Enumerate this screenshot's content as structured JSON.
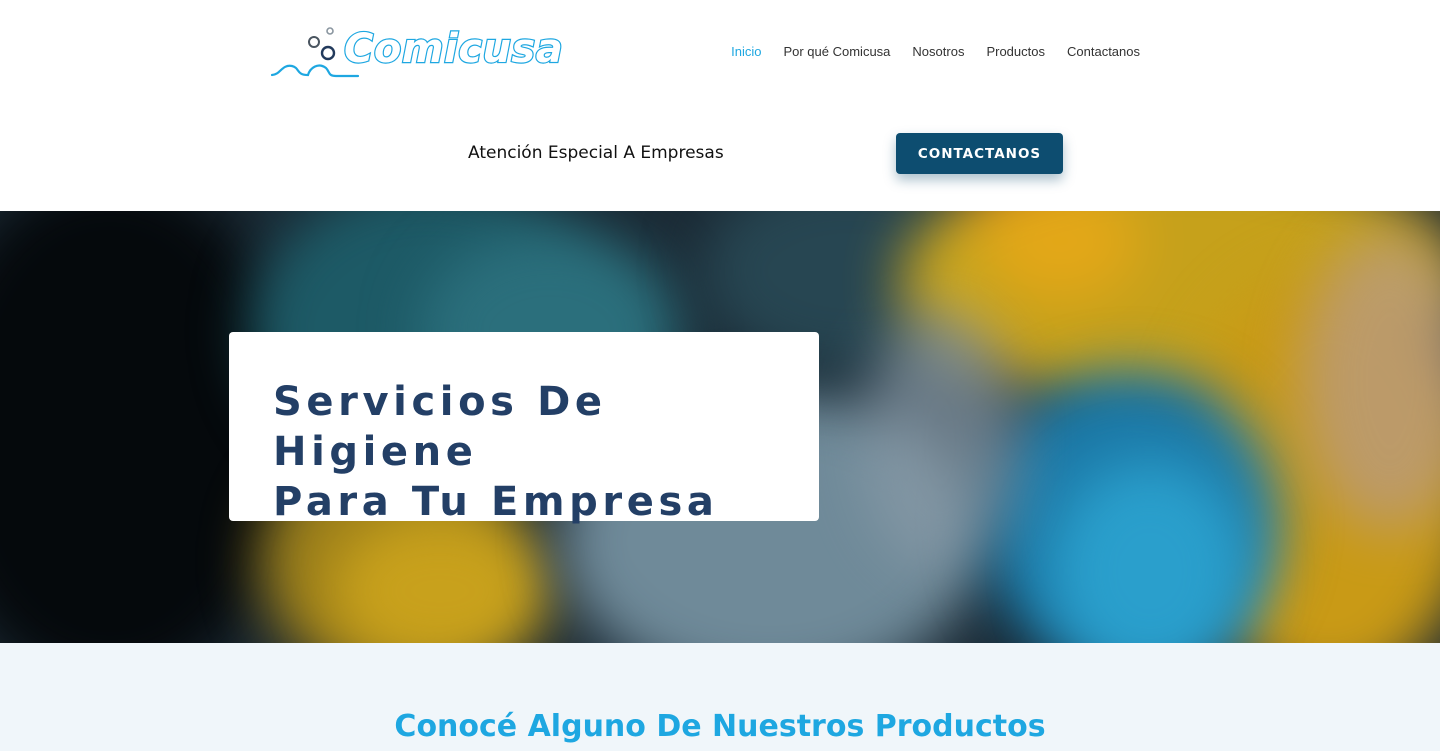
{
  "brand": {
    "name": "Comicusa",
    "color": "#1ea7e1",
    "logo_icon": "bubbles-wave-icon"
  },
  "nav": {
    "items": [
      {
        "label": "Inicio",
        "active": true
      },
      {
        "label": "Por qué Comicusa",
        "active": false
      },
      {
        "label": "Nosotros",
        "active": false
      },
      {
        "label": "Productos",
        "active": false
      },
      {
        "label": "Contactanos",
        "active": false
      }
    ]
  },
  "subheader": {
    "text": "Atención Especial A Empresas",
    "cta_label": "CONTACTANOS",
    "cta_color": "#0d4d70"
  },
  "hero": {
    "title_line1": "Servicios De Higiene",
    "title_line2": "Para Tu Empresa",
    "title_color": "#233f66"
  },
  "products": {
    "title": "Conocé Alguno De Nuestros Productos"
  }
}
